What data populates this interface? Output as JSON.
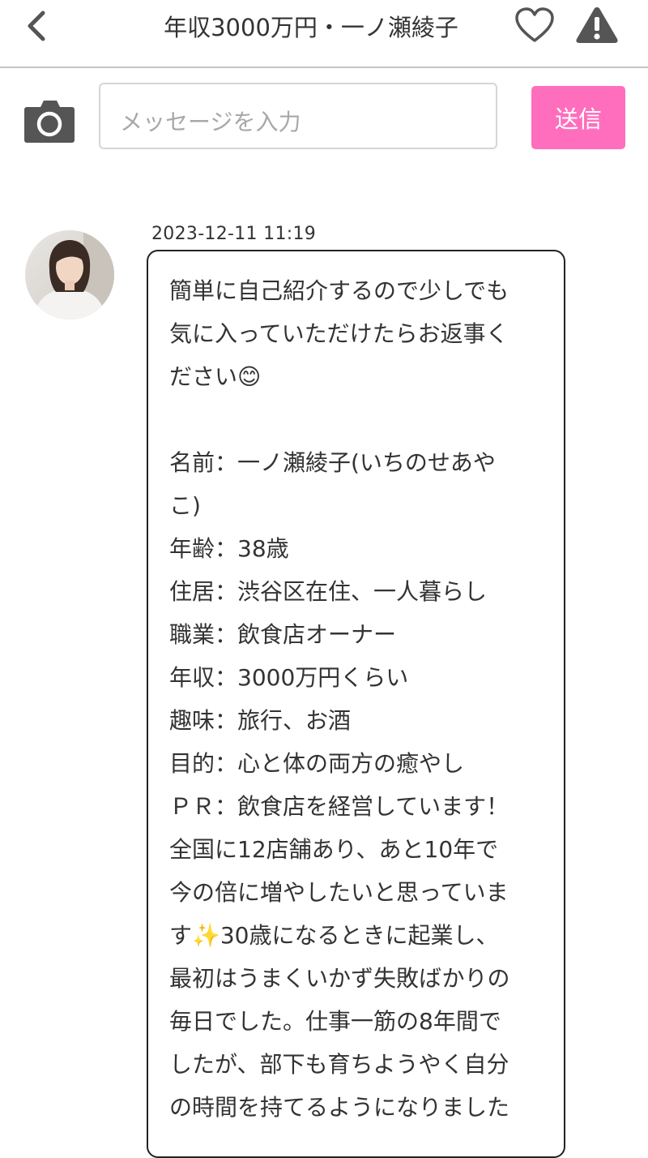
{
  "header": {
    "title": "年収3000万円・一ノ瀬綾子",
    "back_icon": "chevron-left-icon",
    "favorite_icon": "heart-outline-icon",
    "report_icon": "warning-triangle-icon"
  },
  "composer": {
    "camera_icon": "camera-icon",
    "placeholder": "メッセージを入力",
    "value": "",
    "send_label": "送信",
    "send_color": "#ff6ebd"
  },
  "message": {
    "avatar_icon": "user-avatar-photo",
    "timestamp": "2023-12-11 11:19",
    "lines": [
      "簡単に自己紹介するので少しでも",
      "気に入っていただけたらお返事く",
      "ださい😊",
      "",
      "名前：一ノ瀬綾子(いちのせあや",
      "こ)",
      "年齢：38歳",
      "住居：渋谷区在住、一人暮らし",
      "職業：飲食店オーナー",
      "年収：3000万円くらい",
      "趣味：旅行、お酒",
      "目的：心と体の両方の癒やし",
      "ＰＲ：飲食店を経営しています！",
      "全国に12店舗あり、あと10年で",
      "今の倍に増やしたいと思っていま",
      "す✨30歳になるときに起業し、",
      "最初はうまくいかず失敗ばかりの",
      "毎日でした。仕事一筋の8年間で",
      "したが、部下も育ちようやく自分",
      "の時間を持てるようになりました"
    ]
  }
}
